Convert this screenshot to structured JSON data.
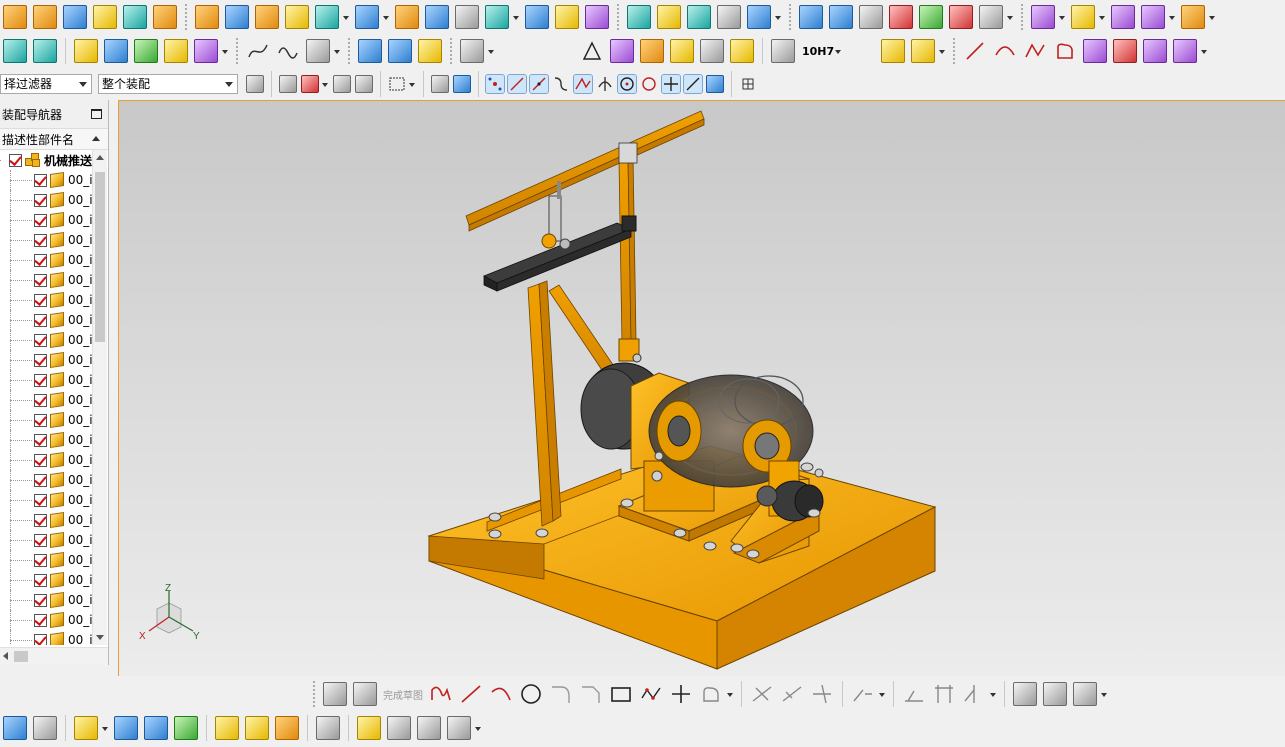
{
  "toolbar": {
    "selection_filter": "择过滤器",
    "assembly_scope": "整个装配",
    "finish_sketch_label": "完成草图",
    "fit_tolerance_label": "10H7"
  },
  "navigator": {
    "title": "装配导航器",
    "column_header": "描述性部件名",
    "root_label": "机械推送",
    "items": [
      "00_i",
      "00_i",
      "00_i",
      "00_i",
      "00_i",
      "00_i",
      "00_i",
      "00_i",
      "00_i",
      "00_i",
      "00_i",
      "00_i",
      "00_i",
      "00_i",
      "00_i",
      "00_i",
      "00_i",
      "00_i",
      "00_i",
      "00_i",
      "00_i",
      "00_i",
      "00_i",
      "00_i"
    ]
  },
  "triad": {
    "x_label": "X",
    "y_label": "Y",
    "z_label": "Z"
  },
  "colors": {
    "model_orange": "#f5a800",
    "viewport_border": "#e8a030"
  }
}
